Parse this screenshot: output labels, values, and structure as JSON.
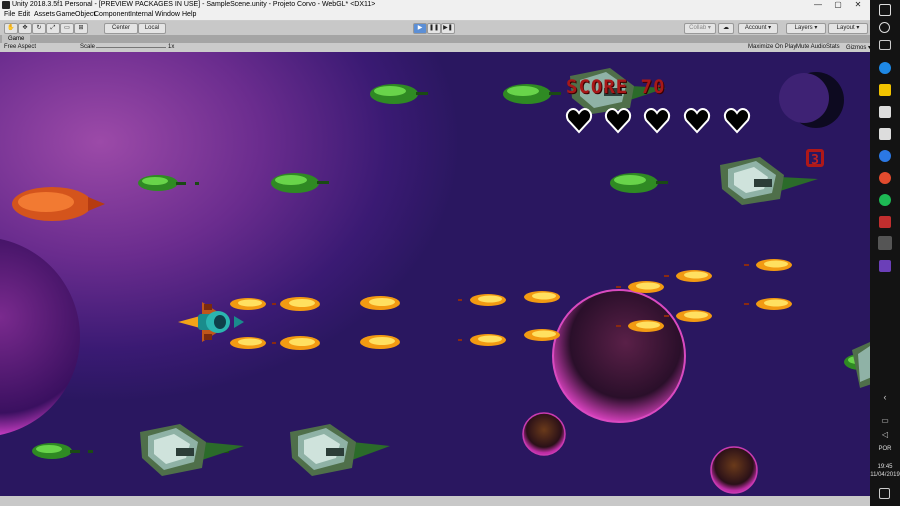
{
  "window": {
    "title": "Unity 2018.3.5f1 Personal - [PREVIEW PACKAGES IN USE] - SampleScene.unity - Projeto Corvo - WebGL* <DX11>",
    "minimize": "—",
    "maximize": "▢",
    "close": "✕"
  },
  "menu": [
    "File",
    "Edit",
    "Assets",
    "GameObject",
    "Component",
    "Internal",
    "Window",
    "Help"
  ],
  "toolbar": {
    "pivot": "Center",
    "space": "Local",
    "collab": "Collab ▾",
    "account": "Account ▾",
    "layers": "Layers ▾",
    "layout": "Layout ▾"
  },
  "tab": {
    "label": "Game"
  },
  "gamebar": {
    "aspect": "Free Aspect",
    "scale_label": "Scale",
    "scale_value": "1x",
    "maximize": "Maximize On Play",
    "mute": "Mute Audio",
    "stats": "Stats",
    "gizmos": "Gizmos ▾"
  },
  "hud": {
    "score": "SCORE 70",
    "bombs": "3",
    "lives": 5
  },
  "taskbar": {
    "language": "POR",
    "time": "19:45",
    "date": "11/04/2019"
  },
  "colors": {
    "space_dark": "#2a1760",
    "space_light": "#9c4aa8",
    "enemy_bullet": "#5bc43a",
    "player_bullet": "#ffc20e",
    "hud_red": "#a81818"
  }
}
